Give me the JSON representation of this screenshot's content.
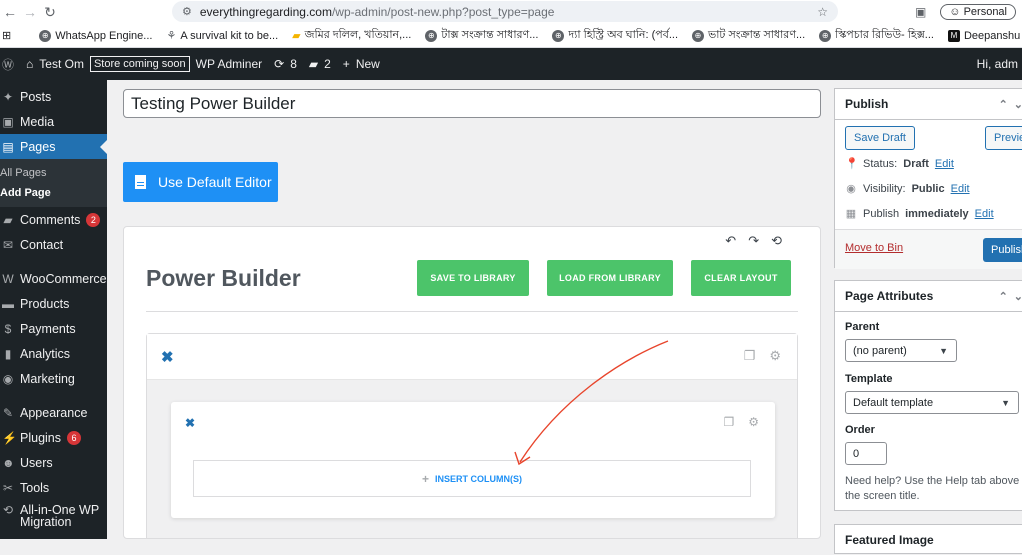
{
  "browser": {
    "url_domain": "everythingregarding.com",
    "url_path": "/wp-admin/post-new.php?post_type=page",
    "profile_label": "Personal",
    "bookmarks": [
      "WhatsApp Engine...",
      "A survival kit to be...",
      "জমির দলিল, খতিয়ান,...",
      "টাক্স সংক্রান্ত সাধারণ...",
      "দ্যা হিস্ট্রি অব ঘানি: (পর্ব...",
      "ভাট সংক্রান্ত সাধারণ...",
      "স্কিপচার রিভিউ- হিক্স...",
      "Deepanshu Giri –..."
    ]
  },
  "adminbar": {
    "site_name": "Test Om",
    "store_badge": "Store coming soon",
    "plugin_link": "WP Adminer",
    "updates_count": "8",
    "comments_count": "2",
    "new_label": "New",
    "greeting": "Hi, adm"
  },
  "sidebar": {
    "items": [
      {
        "label": "Posts",
        "icon": "pin-icon"
      },
      {
        "label": "Media",
        "icon": "media-icon"
      },
      {
        "label": "Pages",
        "icon": "pages-icon"
      },
      {
        "label": "Comments",
        "icon": "comment-icon",
        "badge": "2"
      },
      {
        "label": "Contact",
        "icon": "mail-icon"
      },
      {
        "label": "WooCommerce",
        "icon": "woo-icon"
      },
      {
        "label": "Products",
        "icon": "archive-icon"
      },
      {
        "label": "Payments",
        "icon": "payments-icon"
      },
      {
        "label": "Analytics",
        "icon": "bar-chart-icon"
      },
      {
        "label": "Marketing",
        "icon": "megaphone-icon"
      },
      {
        "label": "Appearance",
        "icon": "brush-icon"
      },
      {
        "label": "Plugins",
        "icon": "plugin-icon",
        "badge": "6"
      },
      {
        "label": "Users",
        "icon": "users-icon"
      },
      {
        "label": "Tools",
        "icon": "wrench-icon"
      },
      {
        "label": "All-in-One WP Migration",
        "icon": "migration-icon"
      }
    ],
    "submenu": [
      "All Pages",
      "Add Page"
    ]
  },
  "editor": {
    "title_value": "Testing Power Builder",
    "default_editor_label": "Use Default Editor",
    "builder_title": "Power Builder",
    "save_library": "SAVE TO LIBRARY",
    "load_library": "LOAD FROM LIBRARY",
    "clear_layout": "CLEAR LAYOUT",
    "insert_column": "INSERT COLUMN(S)"
  },
  "publish": {
    "heading": "Publish",
    "save_draft": "Save Draft",
    "preview": "Preview",
    "status_label": "Status:",
    "status_value": "Draft",
    "visibility_label": "Visibility:",
    "visibility_value": "Public",
    "publish_label": "Publish",
    "publish_when": "immediately",
    "edit": "Edit",
    "move_to_bin": "Move to Bin",
    "publish_button": "Publish"
  },
  "page_attributes": {
    "heading": "Page Attributes",
    "parent_label": "Parent",
    "parent_value": "(no parent)",
    "template_label": "Template",
    "template_value": "Default template",
    "order_label": "Order",
    "order_value": "0",
    "help": "Need help? Use the Help tab above the screen title."
  },
  "featured_box_heading": "Featured Image",
  "colors": {
    "wp_blue": "#2271b1",
    "builder_green": "#4cc46a",
    "editor_blue": "#1e90f5",
    "annotation_red": "#e8452c"
  }
}
